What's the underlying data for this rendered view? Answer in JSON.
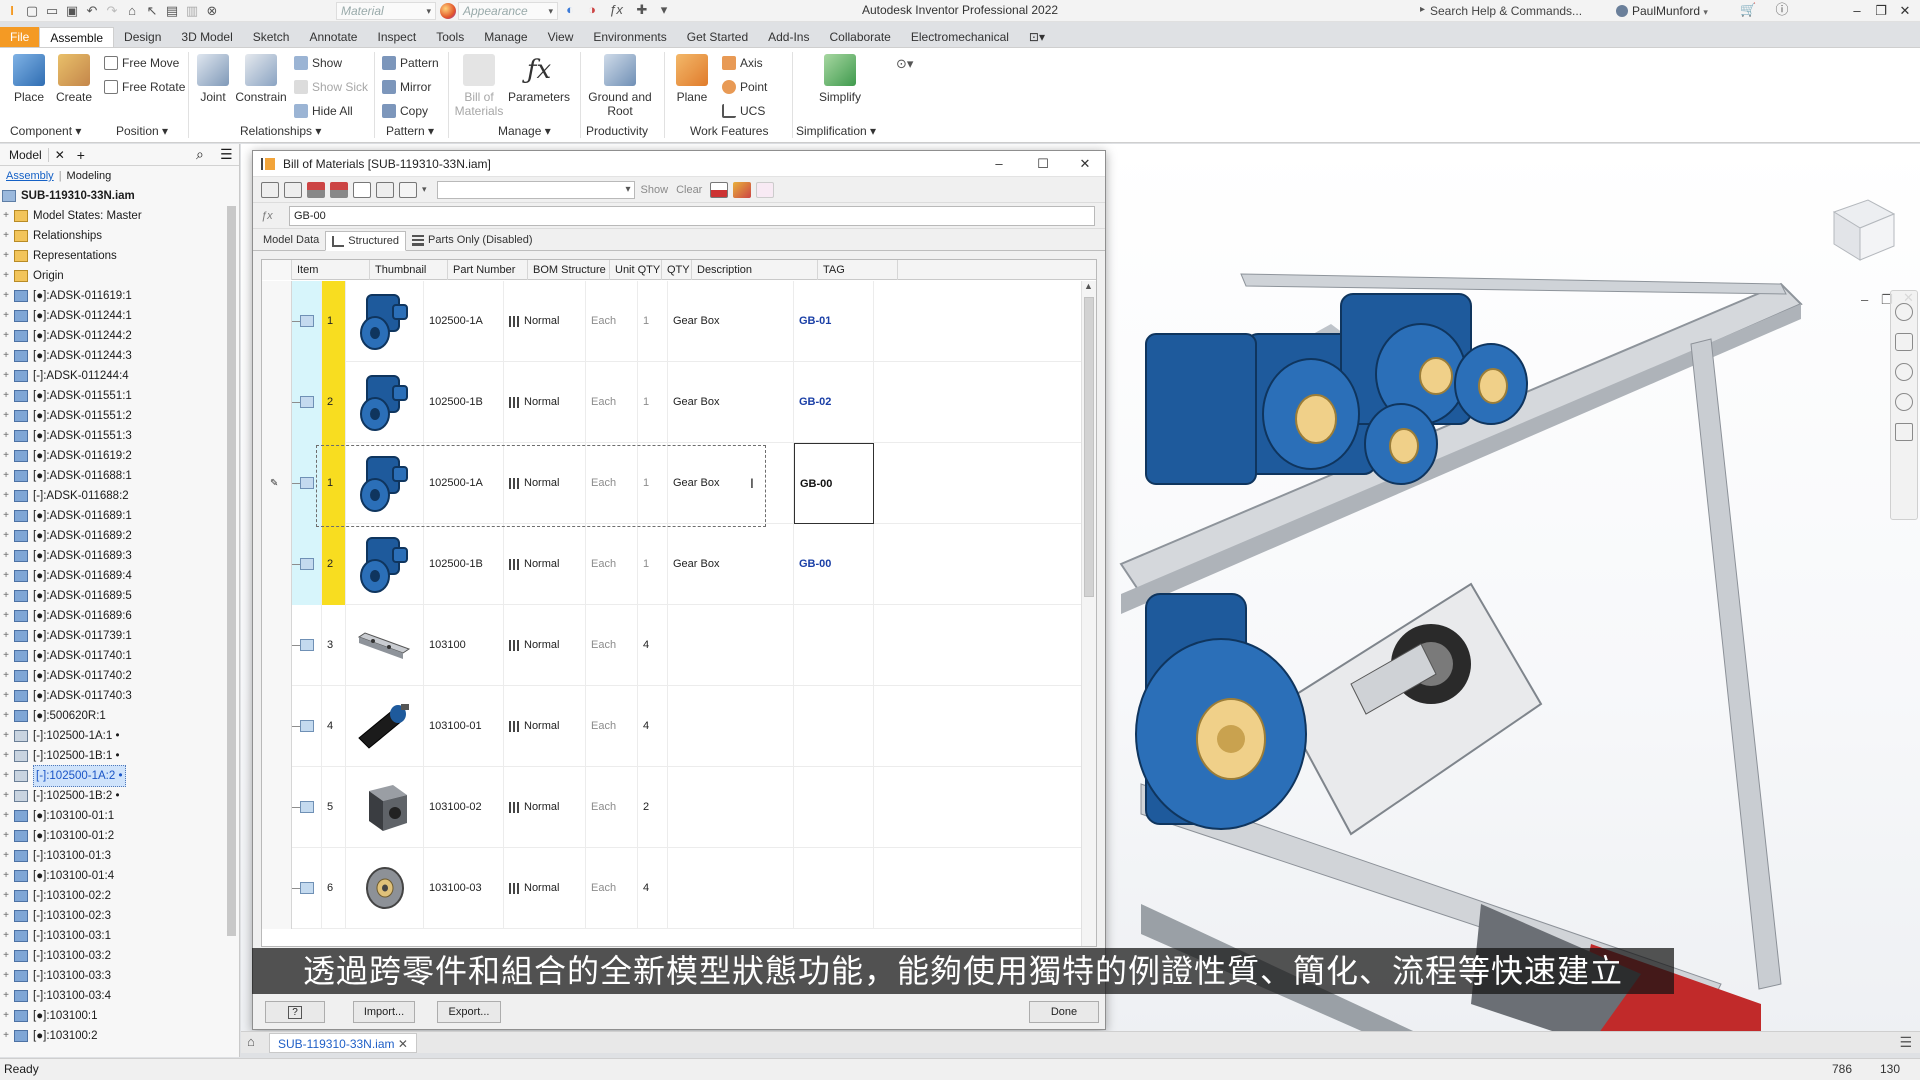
{
  "title_bar": {
    "app_title": "Autodesk Inventor Professional 2022",
    "material_label": "Material",
    "appearance_label": "Appearance",
    "search_placeholder": "Search Help & Commands...",
    "user": "PaulMunford"
  },
  "ribbon": {
    "tabs": [
      "File",
      "Assemble",
      "Design",
      "3D Model",
      "Sketch",
      "Annotate",
      "Inspect",
      "Tools",
      "Manage",
      "View",
      "Environments",
      "Get Started",
      "Add-Ins",
      "Collaborate",
      "Electromechanical"
    ],
    "active_tab": "Assemble",
    "buttons": {
      "place": "Place",
      "create": "Create",
      "free_move": "Free Move",
      "free_rotate": "Free Rotate",
      "joint": "Joint",
      "constrain": "Constrain",
      "show": "Show",
      "show_sick": "Show Sick",
      "hide_all": "Hide All",
      "pattern": "Pattern",
      "mirror": "Mirror",
      "copy": "Copy",
      "bill_of": "Bill of",
      "materials": "Materials",
      "parameters": "Parameters",
      "ground_and": "Ground and",
      "root": "Root",
      "plane": "Plane",
      "axis": "Axis",
      "point": "Point",
      "ucs": "UCS",
      "simplify": "Simplify"
    },
    "panels": [
      "Component",
      "Position",
      "Relationships",
      "Pattern",
      "Manage",
      "Productivity",
      "Work Features",
      "Simplification"
    ]
  },
  "browser": {
    "header": "Model",
    "tabs": [
      "Assembly",
      "Modeling"
    ],
    "root": "SUB-119310-33N.iam",
    "items": [
      "Model States: Master",
      "Relationships",
      "Representations",
      "Origin",
      "[●]:ADSK-011619:1",
      "[●]:ADSK-011244:1",
      "[●]:ADSK-011244:2",
      "[●]:ADSK-011244:3",
      "[-]:ADSK-011244:4",
      "[●]:ADSK-011551:1",
      "[●]:ADSK-011551:2",
      "[●]:ADSK-011551:3",
      "[●]:ADSK-011619:2",
      "[●]:ADSK-011688:1",
      "[-]:ADSK-011688:2",
      "[●]:ADSK-011689:1",
      "[●]:ADSK-011689:2",
      "[●]:ADSK-011689:3",
      "[●]:ADSK-011689:4",
      "[●]:ADSK-011689:5",
      "[●]:ADSK-011689:6",
      "[●]:ADSK-011739:1",
      "[●]:ADSK-011740:1",
      "[●]:ADSK-011740:2",
      "[●]:ADSK-011740:3",
      "[●]:500620R:1",
      "[-]:102500-1A:1 •",
      "[-]:102500-1B:1 •",
      "[-]:102500-1A:2 •",
      "[-]:102500-1B:2 •",
      "[●]:103100-01:1",
      "[●]:103100-01:2",
      "[-]:103100-01:3",
      "[●]:103100-01:4",
      "[-]:103100-02:2",
      "[-]:103100-02:3",
      "[-]:103100-03:1",
      "[-]:103100-03:2",
      "[-]:103100-03:3",
      "[-]:103100-03:4",
      "[●]:103100:1",
      "[●]:103100:2"
    ],
    "selected_index": 28
  },
  "bom": {
    "title": "Bill of Materials [SUB-119310-33N.iam]",
    "toolbar": {
      "show": "Show",
      "clear": "Clear"
    },
    "formula_value": "GB-00",
    "tabs": [
      "Model Data",
      "Structured",
      "Parts Only (Disabled)"
    ],
    "active_tab": "Structured",
    "columns": [
      "Item",
      "Thumbnail",
      "Part Number",
      "BOM Structure",
      "Unit QTY",
      "QTY",
      "Description",
      "TAG"
    ],
    "rows": [
      {
        "item": "1",
        "part": "102500-1A",
        "structure": "Normal",
        "unit": "Each",
        "qty": "1",
        "desc": "Gear Box",
        "tag": "GB-01",
        "thumb": "gearbox"
      },
      {
        "item": "2",
        "part": "102500-1B",
        "structure": "Normal",
        "unit": "Each",
        "qty": "1",
        "desc": "Gear Box",
        "tag": "GB-02",
        "thumb": "gearbox"
      },
      {
        "item": "1",
        "part": "102500-1A",
        "structure": "Normal",
        "unit": "Each",
        "qty": "1",
        "desc": "Gear Box",
        "tag": "GB-00",
        "thumb": "gearbox"
      },
      {
        "item": "2",
        "part": "102500-1B",
        "structure": "Normal",
        "unit": "Each",
        "qty": "1",
        "desc": "Gear Box",
        "tag": "GB-00",
        "thumb": "gearbox"
      },
      {
        "item": "3",
        "part": "103100",
        "structure": "Normal",
        "unit": "Each",
        "qty": "4",
        "desc": "",
        "tag": "",
        "thumb": "bracket"
      },
      {
        "item": "4",
        "part": "103100-01",
        "structure": "Normal",
        "unit": "Each",
        "qty": "4",
        "desc": "",
        "tag": "",
        "thumb": "motor"
      },
      {
        "item": "5",
        "part": "103100-02",
        "structure": "Normal",
        "unit": "Each",
        "qty": "2",
        "desc": "",
        "tag": "",
        "thumb": "block"
      },
      {
        "item": "6",
        "part": "103100-03",
        "structure": "Normal",
        "unit": "Each",
        "qty": "4",
        "desc": "",
        "tag": "",
        "thumb": "wheel"
      }
    ],
    "editing_row_index": 2,
    "buttons": {
      "help": "?",
      "import": "Import...",
      "export": "Export...",
      "done": "Done"
    }
  },
  "subtitle": "透過跨零件和組合的全新模型狀態功能，能夠使用獨特的例證性質、簡化、流程等快速建立",
  "document_tab": "SUB-119310-33N.iam",
  "status": {
    "text": "Ready",
    "n1": "786",
    "n2": "130"
  },
  "colors": {
    "accent_blue": "#1f5fc7",
    "file_tab": "#f49a24",
    "item_highlight": "#f8dd20",
    "row_icon_cyan": "#d7f5fb",
    "gearbox_blue": "#1e5a9c"
  }
}
